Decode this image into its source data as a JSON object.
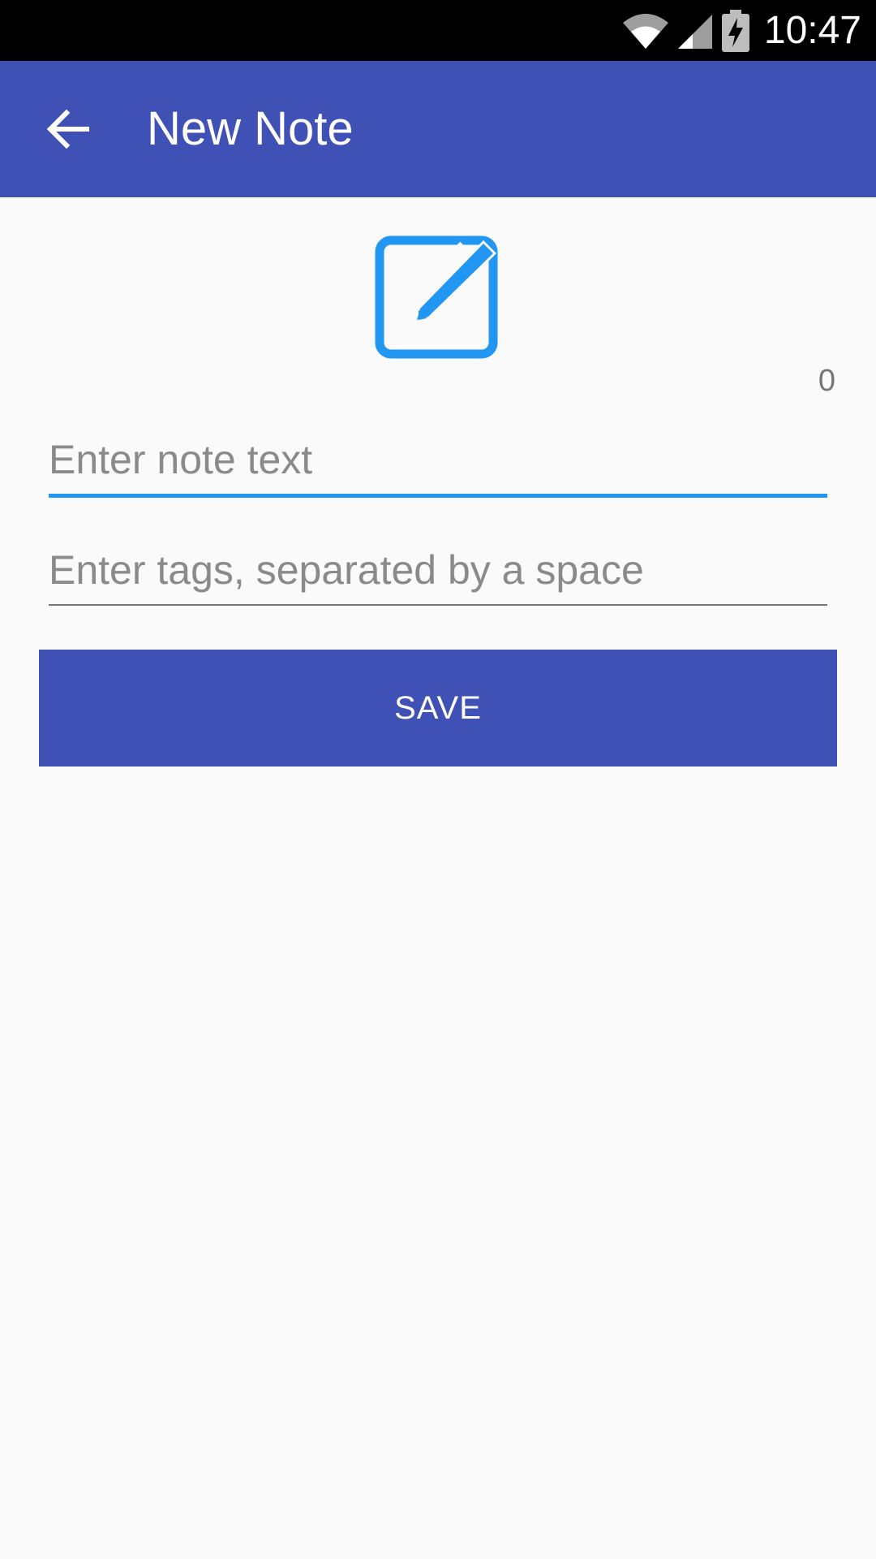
{
  "status_bar": {
    "time": "10:47",
    "icons": [
      "wifi-icon",
      "cellular-signal-icon",
      "battery-charging-icon"
    ]
  },
  "app_bar": {
    "title": "New Note",
    "back_icon": "arrow-back-icon",
    "background_color": "#3F51B5"
  },
  "editor": {
    "header_icon": "edit-note-icon",
    "icon_color": "#2196F3",
    "char_count": "0",
    "note_text": {
      "value": "",
      "placeholder": "Enter note text"
    },
    "tags": {
      "value": "",
      "placeholder": "Enter tags, separated by a space"
    }
  },
  "actions": {
    "save_label": "SAVE"
  }
}
